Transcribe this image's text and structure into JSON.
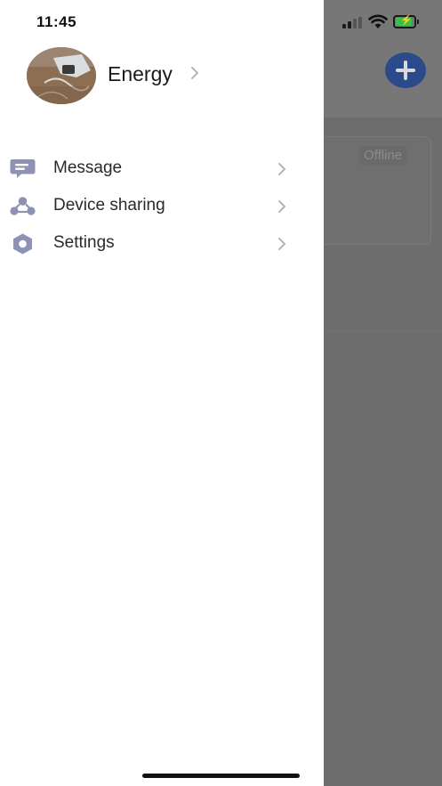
{
  "status_bar": {
    "time": "11:45"
  },
  "profile": {
    "name": "Energy",
    "avatar_icon": "user-avatar-photo"
  },
  "menu": {
    "items": [
      {
        "label": "Message",
        "icon": "message-icon"
      },
      {
        "label": "Device sharing",
        "icon": "device-sharing-icon"
      },
      {
        "label": "Settings",
        "icon": "settings-icon"
      }
    ]
  },
  "background": {
    "device_status": "Offline"
  },
  "colors": {
    "drawer_bg": "#ffffff",
    "overlay": "#6d6d6d",
    "icon": "#8e93b5",
    "chevron": "#b5b5b5",
    "add_button": "#2a4a8c",
    "battery": "#35c24b"
  }
}
